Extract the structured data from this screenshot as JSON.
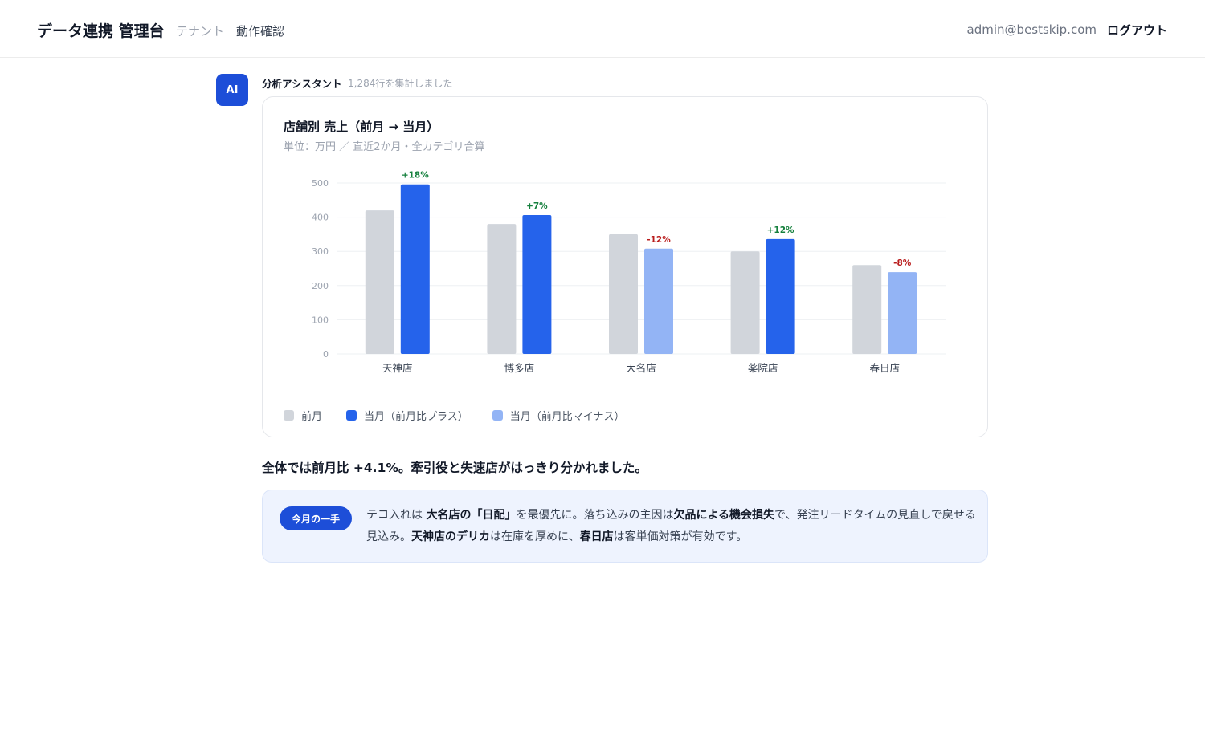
{
  "header": {
    "brand": "データ連携 管理台",
    "nav": {
      "tenant": "テナント",
      "check": "動作確認"
    },
    "user_email": "admin@bestskip.com",
    "logout": "ログアウト"
  },
  "message": {
    "avatar_label": "AI",
    "sender": "分析アシスタント",
    "meta": "1,284行を集計しました"
  },
  "colors": {
    "prev": "#d1d5db",
    "curr_plus": "#2563eb",
    "curr_minus": "#93b4f5",
    "pct_plus": "#15803d",
    "pct_minus": "#b91c1c",
    "accent": "#1d4ed8"
  },
  "chart_data": {
    "type": "bar",
    "title": "店舗別 売上（前月 → 当月）",
    "subtitle": "単位：万円 ／ 直近2か月・全カテゴリ合算",
    "categories": [
      "天神店",
      "博多店",
      "大名店",
      "薬院店",
      "春日店"
    ],
    "series": [
      {
        "name": "前月",
        "values": [
          420,
          380,
          350,
          300,
          260
        ]
      },
      {
        "name": "当月",
        "values": [
          496,
          406,
          308,
          336,
          239
        ]
      }
    ],
    "change_labels": [
      "+18%",
      "+7%",
      "-12%",
      "+12%",
      "-8%"
    ],
    "yticks": [
      0,
      100,
      200,
      300,
      400,
      500
    ],
    "ylim": [
      0,
      500
    ],
    "grid": true,
    "legend_position": "bottom-left",
    "legend": [
      "前月",
      "当月（前月比プラス）",
      "当月（前月比マイナス）"
    ]
  },
  "summary": {
    "prefix": "全体では前月比 ",
    "value": "+4.1%",
    "suffix": "。牽引役と失速店がはっきり分かれました。"
  },
  "tip": {
    "badge": "今月の一手",
    "t1": "テコ入れは ",
    "b1": "大名店の「日配」",
    "t2": "を最優先に。落ち込みの主因は",
    "b2": "欠品による機会損失",
    "t3": "で、発注リードタイムの見直しで戻せる見込み。",
    "b3": "天神店のデリカ",
    "t4": "は在庫を厚めに、",
    "b4": "春日店",
    "t5": "は客単価対策が有効です。"
  }
}
